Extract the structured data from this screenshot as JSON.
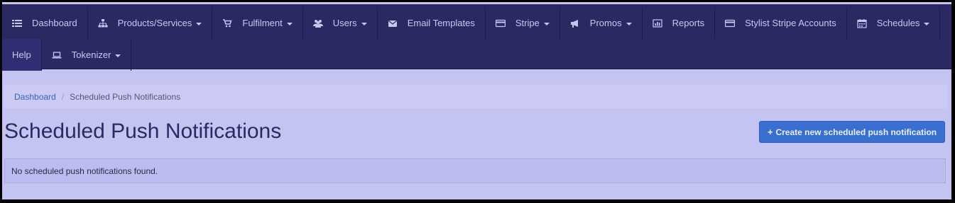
{
  "nav": {
    "row1": [
      {
        "label": "Dashboard",
        "icon": "list-icon",
        "caret": false
      },
      {
        "label": "Products/Services",
        "icon": "sitemap-icon",
        "caret": true
      },
      {
        "label": "Fulfilment",
        "icon": "cart-icon",
        "caret": true
      },
      {
        "label": "Users",
        "icon": "users-icon",
        "caret": true
      },
      {
        "label": "Email Templates",
        "icon": "envelope-icon",
        "caret": false
      },
      {
        "label": "Stripe",
        "icon": "credit-card-icon",
        "caret": true
      },
      {
        "label": "Promos",
        "icon": "bullhorn-icon",
        "caret": true
      },
      {
        "label": "Reports",
        "icon": "bar-chart-icon",
        "caret": false
      },
      {
        "label": "Stylist Stripe Accounts",
        "icon": "credit-card-icon",
        "caret": false
      },
      {
        "label": "Schedules",
        "icon": "calendar-icon",
        "caret": true
      }
    ],
    "row2": [
      {
        "label": "Help",
        "icon": "",
        "caret": false,
        "active": true
      },
      {
        "label": "Tokenizer",
        "icon": "laptop-icon",
        "caret": true
      }
    ]
  },
  "breadcrumb": {
    "home": "Dashboard",
    "current": "Scheduled Push Notifications"
  },
  "page": {
    "title": "Scheduled Push Notifications",
    "create_button": "Create new scheduled push notification",
    "create_button_icon": "plus-icon",
    "empty_message": "No scheduled push notifications found."
  },
  "colors": {
    "navbar_bg": "#2a2a63",
    "page_bg": "#c4c4f2",
    "primary_button": "#3a6fd0",
    "link": "#3b5fc4"
  }
}
